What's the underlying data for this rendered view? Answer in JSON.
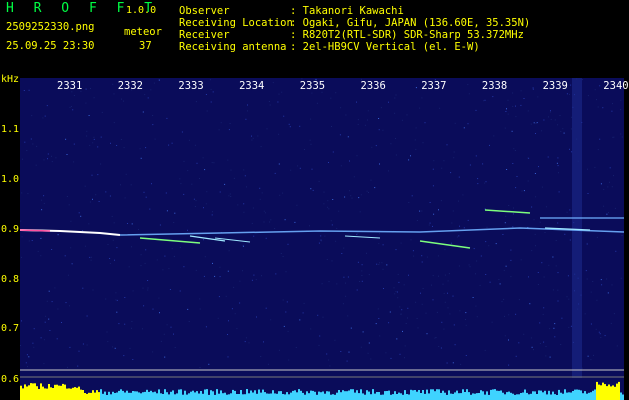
{
  "app": {
    "brand": "H R O F F T",
    "version": "1.0.0",
    "filename": "2509252330.png",
    "datetime": "25.09.25 23:30",
    "count_label": "meteor",
    "count_value": "37"
  },
  "info": {
    "observer_label": "Observer",
    "observer_value": ": Takanori Kawachi",
    "location_label": "Receiving Location",
    "location_value": ": Ogaki, Gifu, JAPAN (136.60E, 35.35N)",
    "receiver_label": "Receiver",
    "receiver_value": ": R820T2(RTL-SDR) SDR-Sharp 53.372MHz",
    "antenna_label": "Receiving antenna",
    "antenna_value": ": 2el-HB9CV Vertical (el. E-W)"
  },
  "axis": {
    "unit": "kHz",
    "y_ticks": [
      "1.1",
      "1.0",
      "0.9",
      "0.8",
      "0.7",
      "0.6"
    ],
    "x_ticks": [
      "2331",
      "2332",
      "2333",
      "2334",
      "2335",
      "2336",
      "2337",
      "2338",
      "2339",
      "2340"
    ]
  },
  "colors": {
    "background": "#000000",
    "spectrogram": "#0a0c5a",
    "signal_line": "#a0d8ff",
    "meteor": "#7dff7d",
    "histogram": "#3fd3ff",
    "histogram_hi": "#ffff00"
  }
}
